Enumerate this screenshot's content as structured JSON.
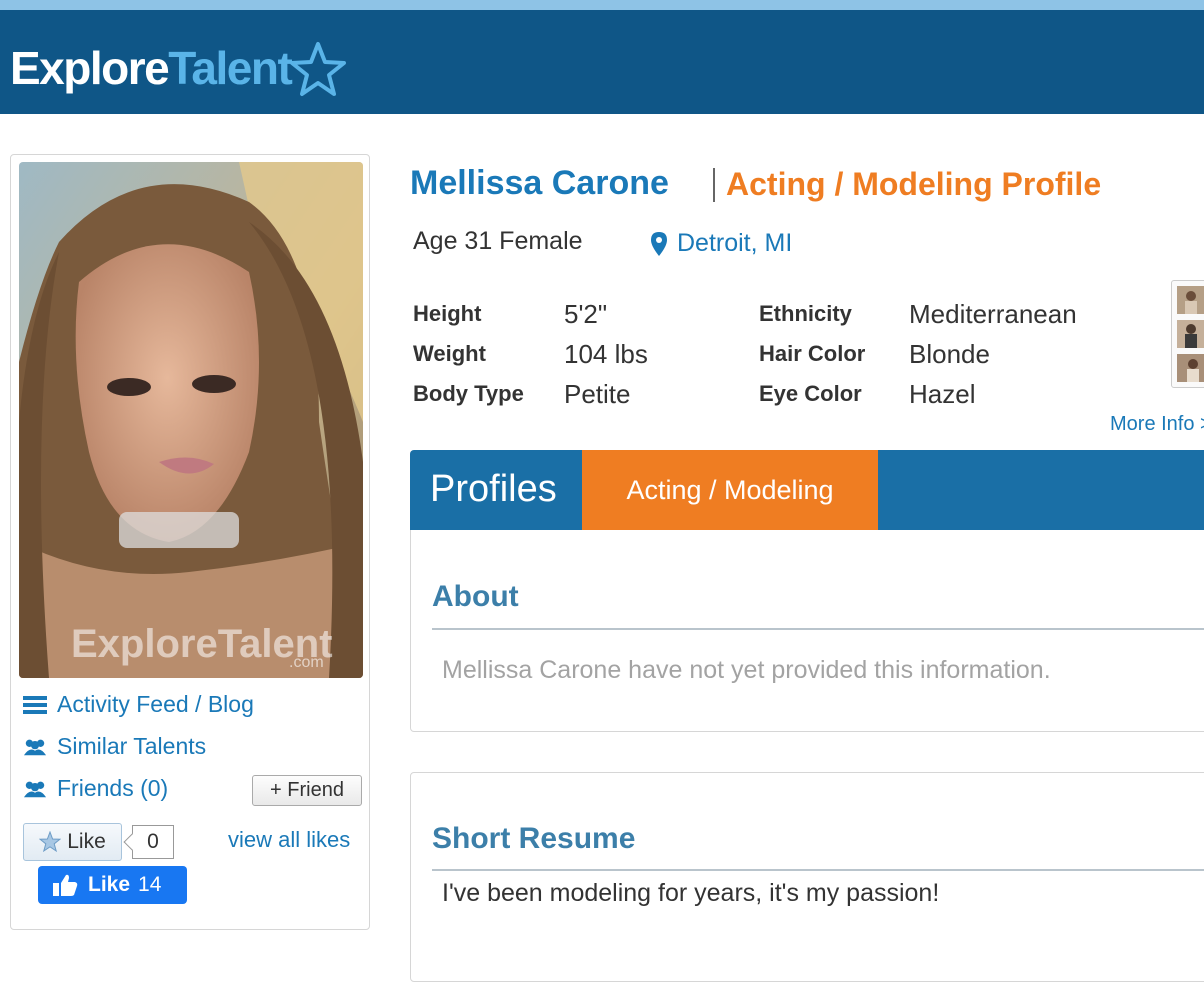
{
  "header": {
    "logo_part1": "Explore",
    "logo_part2": "Talent",
    "logo_icon": "star-outline-icon",
    "bar_color": "#0f5687"
  },
  "sidebar": {
    "photo_watermark": "ExploreTalent",
    "photo_watermark_sub": ".com",
    "links": [
      {
        "label": "Activity Feed / Blog",
        "icon": "list-icon"
      },
      {
        "label": "Similar Talents",
        "icon": "users-icon"
      },
      {
        "label": "Friends (0)",
        "icon": "users-icon"
      }
    ],
    "friend_button": "+ Friend",
    "like_button": "Like",
    "like_count": "0",
    "view_all_likes": "view all likes",
    "fb_like_label": "Like",
    "fb_like_count": "14"
  },
  "profile": {
    "name": "Mellissa Carone",
    "profile_type": "Acting / Modeling Profile",
    "age_gender": "Age 31 Female",
    "location": "Detroit, MI",
    "attributes_left": [
      {
        "label": "Height",
        "value": "5'2\""
      },
      {
        "label": "Weight",
        "value": "104 lbs"
      },
      {
        "label": "Body Type",
        "value": "Petite"
      }
    ],
    "attributes_right": [
      {
        "label": "Ethnicity",
        "value": "Mediterranean"
      },
      {
        "label": "Hair Color",
        "value": "Blonde"
      },
      {
        "label": "Eye Color",
        "value": "Hazel"
      }
    ],
    "more_info": "More Info >"
  },
  "tabs": {
    "title": "Profiles",
    "active_tab": "Acting / Modeling"
  },
  "about": {
    "title": "About",
    "text": "Mellissa Carone have not yet provided this information."
  },
  "resume": {
    "title": "Short Resume",
    "text": "I've been modeling for years, it's my passion!"
  },
  "colors": {
    "brand_blue": "#1a79b8",
    "accent_orange": "#ef7d22",
    "facebook_blue": "#1877f2"
  }
}
